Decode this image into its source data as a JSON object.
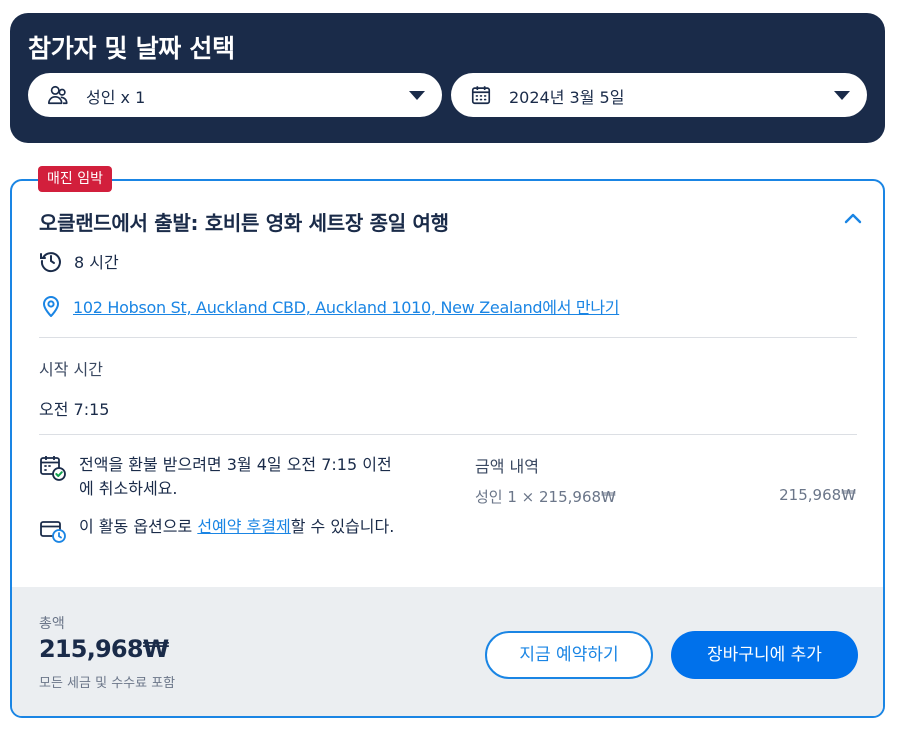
{
  "header": {
    "title": "참가자 및 날짜 선택",
    "participants": {
      "label": "성인",
      "count": "x 1",
      "icon": "people-icon"
    },
    "date": {
      "value": "2024년 3월 5일",
      "icon": "calendar-icon"
    }
  },
  "option": {
    "badge": "매진 임박",
    "title": "오클랜드에서 출발: 호비튼 영화 세트장 종일 여행",
    "duration": "8 시간",
    "meeting_point_link": "102 Hobson St, Auckland CBD, Auckland 1010, New Zealand에서 만나기",
    "start_time_label": "시작 시간",
    "start_time_value": "오전 7:15",
    "refund_policy": "전액을 환불 받으려면 3월 4일 오전 7:15 이전에 취소하세요.",
    "pay_later_prefix": "이 활동 옵션으로 ",
    "pay_later_link": "선예약 후결제",
    "pay_later_suffix": "할 수 있습니다.",
    "price_breakdown_label": "금액 내역",
    "price_line": "성인 1 × 215,968₩",
    "price_line_amount": "215,968₩"
  },
  "footer": {
    "total_label": "총액",
    "total_value": "215,968₩",
    "total_note": "모든 세금 및 수수료 포함",
    "book_now_label": "지금 예약하기",
    "add_to_cart_label": "장바구니에 추가"
  },
  "colors": {
    "navy": "#1a2b49",
    "accent_blue": "#0071eb",
    "link_blue": "#1a85e4",
    "badge_red": "#d21f3c",
    "footer_bg": "#ebeef1"
  }
}
